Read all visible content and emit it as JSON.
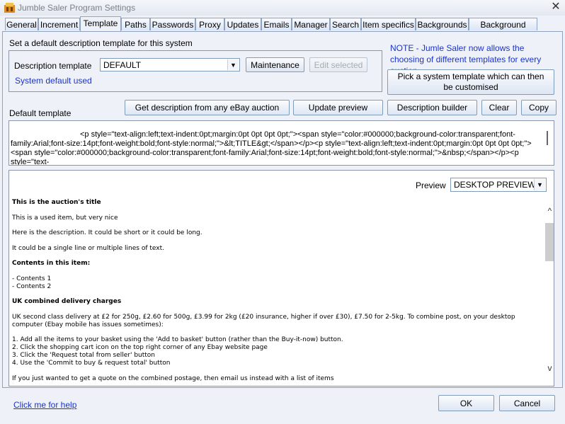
{
  "window": {
    "title": "Jumble Saler Program Settings",
    "close_glyph": "✕"
  },
  "tabs": [
    {
      "label": "General"
    },
    {
      "label": "Increment"
    },
    {
      "label": "Template"
    },
    {
      "label": "Paths"
    },
    {
      "label": "Passwords"
    },
    {
      "label": "Proxy"
    },
    {
      "label": "Updates"
    },
    {
      "label": "Emails"
    },
    {
      "label": "Manager"
    },
    {
      "label": "Search"
    },
    {
      "label": "Item specifics"
    },
    {
      "label": "Backgrounds"
    },
    {
      "label": "Background paths"
    }
  ],
  "active_tab": "Template",
  "template": {
    "heading": "Set a default description template for this system",
    "description_template_label": "Description template",
    "description_template_value": "DEFAULT",
    "maintenance_label": "Maintenance",
    "edit_selected_label": "Edit selected",
    "status_text": "System default used",
    "note": "NOTE - Jumle Saler now allows the choosing of different templates for every auction",
    "pick_system_template_label": "Pick a system template which can then be customised",
    "default_template_label": "Default template",
    "get_description_label": "Get description from any eBay auction",
    "update_preview_label": "Update preview",
    "description_builder_label": "Description builder",
    "clear_label": "Clear",
    "copy_label": "Copy",
    "code_text": "<p style=\"text-align:left;text-indent:0pt;margin:0pt 0pt 0pt 0pt;\"><span style=\"color:#000000;background-color:transparent;font-family:Arial;font-size:14pt;font-weight:bold;font-style:normal;\">&lt;TITLE&gt;</span></p><p style=\"text-align:left;text-indent:0pt;margin:0pt 0pt 0pt 0pt;\"><span style=\"color:#000000;background-color:transparent;font-family:Arial;font-size:14pt;font-weight:bold;font-style:normal;\">&nbsp;</span></p><p style=\"text-",
    "preview_label": "Preview",
    "preview_mode": "DESKTOP PREVIEW"
  },
  "preview": {
    "title": "This is the auction's title",
    "line1": "This is a used item, but very nice",
    "line2": "Here is the description. It could be short or it could be long.",
    "line3": "It could be a single line or multiple lines of text.",
    "contents_heading": "Contents in this item:",
    "contents_1": "- Contents 1",
    "contents_2": "- Contents 2",
    "delivery_heading": "UK combined delivery charges",
    "delivery_text": "UK second class delivery at £2 for 250g, £2.60 for 500g, £3.99 for 2kg (£20 insurance, higher if over £30), £7.50 for 2-5kg.   To combine post, on your desktop computer (Ebay mobile has issues sometimes):",
    "step1": "1.  Add all the items to your basket using the 'Add to basket' button (rather than the Buy-it-now) button.",
    "step2": "2.  Click the shopping cart icon on the top right corner of any Ebay website page",
    "step3": "3.  Click the 'Request total from seller' button",
    "step4": "4.  Use the 'Commit to buy & request total' button",
    "cut_line": "If you just wanted to get a quote on the combined postage, then email us instead with a list of items"
  },
  "footer": {
    "help_link": "Click me for help",
    "ok_label": "OK",
    "cancel_label": "Cancel"
  },
  "icons": {
    "scroll_up": "^",
    "scroll_down": "v",
    "dropdown": "▼"
  }
}
